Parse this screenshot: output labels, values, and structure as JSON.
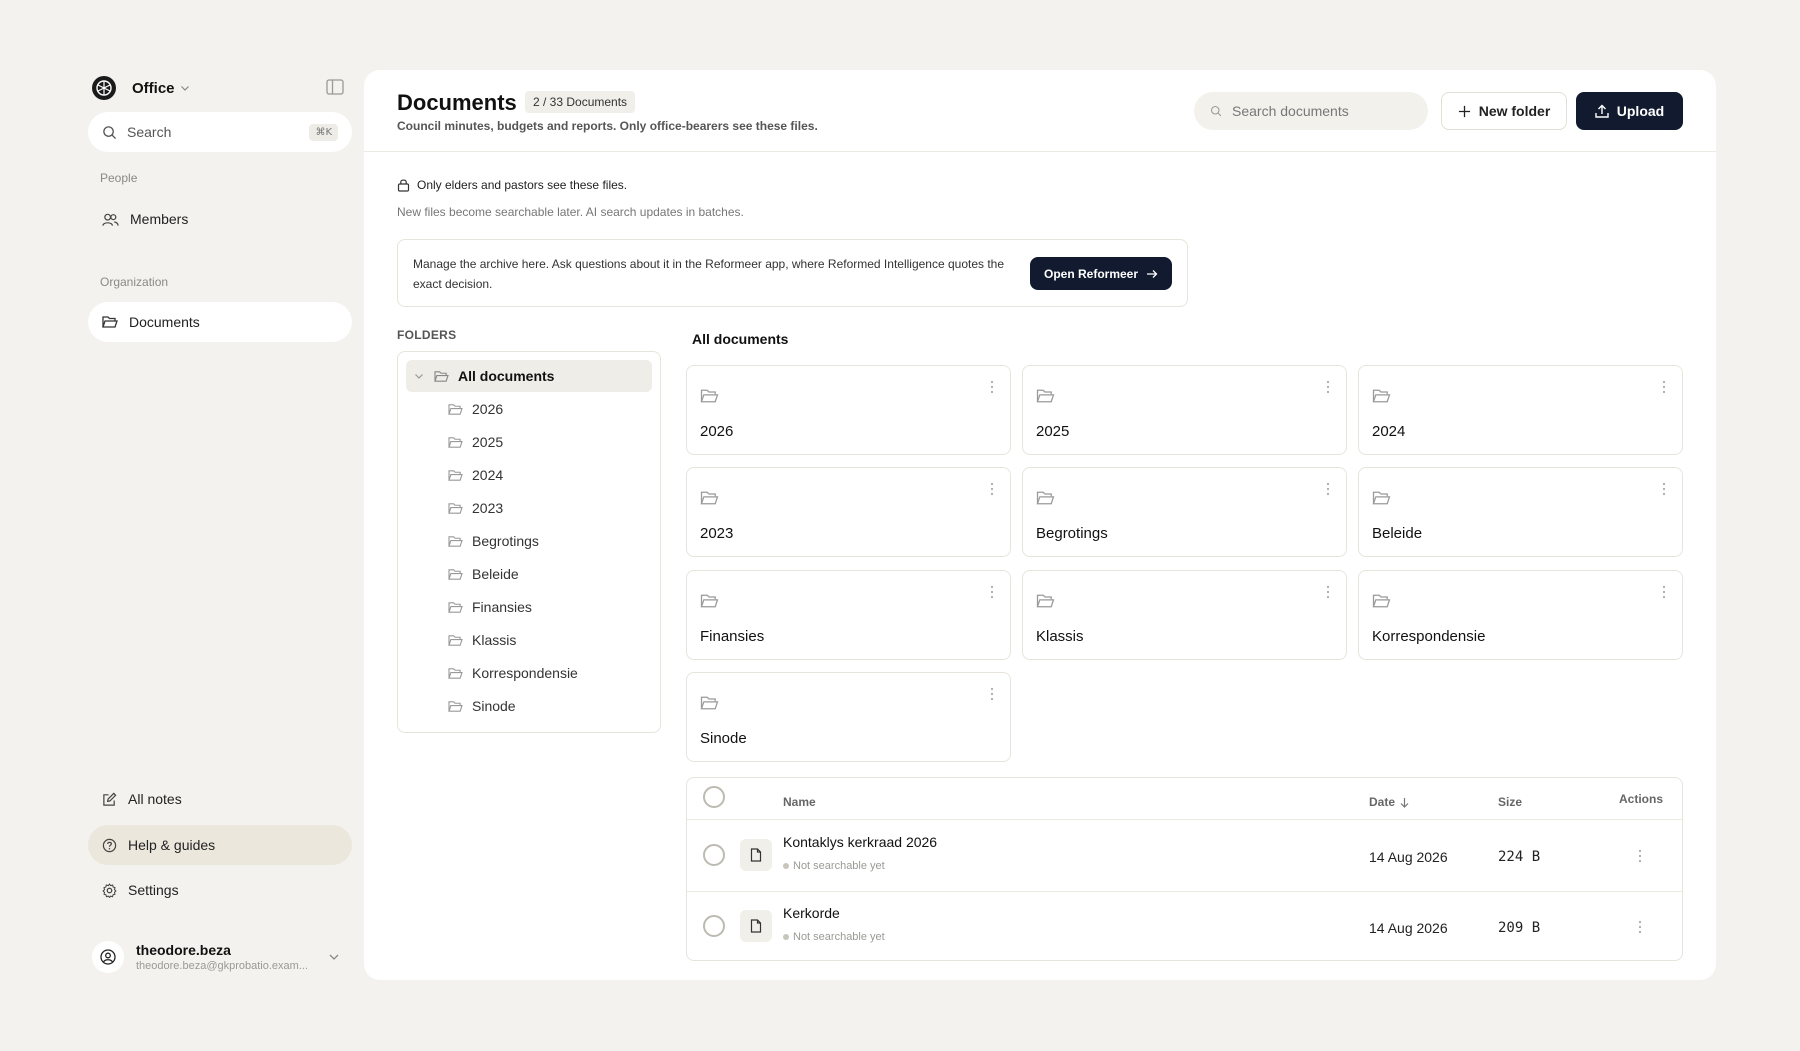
{
  "sidebar": {
    "org_name": "Office",
    "search_label": "Search",
    "search_shortcut": "⌘K",
    "section_people": "People",
    "members_label": "Members",
    "section_org": "Organization",
    "documents_label": "Documents",
    "all_notes_label": "All notes",
    "help_label": "Help & guides",
    "settings_label": "Settings",
    "user_name": "theodore.beza",
    "user_email": "theodore.beza@gkprobatio.exam..."
  },
  "header": {
    "title": "Documents",
    "count": "2 / 33 Documents",
    "subtitle": "Council minutes, budgets and reports. Only office-bearers see these files.",
    "search_placeholder": "Search documents",
    "new_folder_label": "New folder",
    "upload_label": "Upload"
  },
  "notices": {
    "restricted": "Only elders and pastors see these files.",
    "search_batch": "New files become searchable later. AI search updates in batches.",
    "callout_text": "Manage the archive here. Ask questions about it in the Reformeer app, where Reformed Intelligence quotes the exact decision.",
    "callout_button": "Open Reformeer"
  },
  "tree": {
    "heading": "FOLDERS",
    "root": "All documents",
    "children": [
      "2026",
      "2025",
      "2024",
      "2023",
      "Begrotings",
      "Beleide",
      "Finansies",
      "Klassis",
      "Korrespondensie",
      "Sinode"
    ]
  },
  "grid": {
    "heading": "All documents",
    "folders": [
      "2026",
      "2025",
      "2024",
      "2023",
      "Begrotings",
      "Beleide",
      "Finansies",
      "Klassis",
      "Korrespondensie",
      "Sinode"
    ]
  },
  "table": {
    "columns": {
      "name": "Name",
      "date": "Date",
      "size": "Size",
      "actions": "Actions"
    },
    "rows": [
      {
        "name": "Kontaklys kerkraad 2026",
        "status": "Not searchable yet",
        "date": "14 Aug 2026",
        "size": "224 B"
      },
      {
        "name": "Kerkorde",
        "status": "Not searchable yet",
        "date": "14 Aug 2026",
        "size": "209 B"
      }
    ]
  },
  "colors": {
    "accent_dark": "#111a2e",
    "page_bg": "#f3f2ee",
    "active_hilite": "#ebe7dc"
  }
}
